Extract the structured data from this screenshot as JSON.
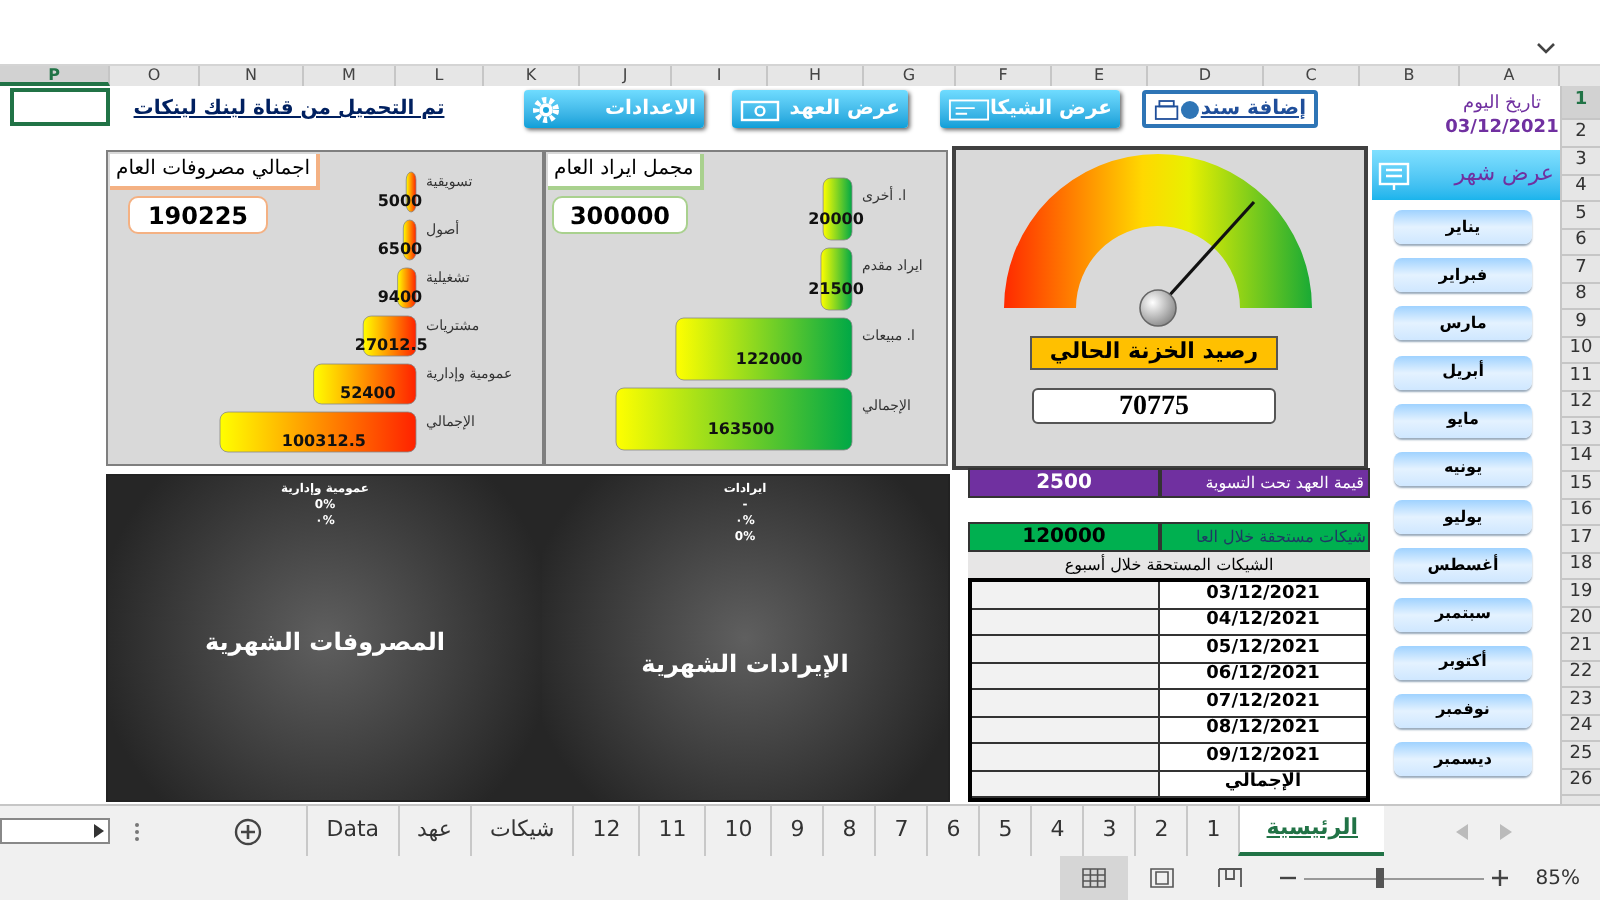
{
  "columns": [
    {
      "label": "A",
      "selected": false
    },
    {
      "label": "B",
      "selected": false
    },
    {
      "label": "C",
      "selected": false
    },
    {
      "label": "D",
      "selected": false
    },
    {
      "label": "E",
      "selected": false
    },
    {
      "label": "F",
      "selected": false
    },
    {
      "label": "G",
      "selected": false
    },
    {
      "label": "H",
      "selected": false
    },
    {
      "label": "I",
      "selected": false
    },
    {
      "label": "J",
      "selected": false
    },
    {
      "label": "K",
      "selected": false
    },
    {
      "label": "L",
      "selected": false
    },
    {
      "label": "M",
      "selected": false
    },
    {
      "label": "N",
      "selected": false
    },
    {
      "label": "O",
      "selected": false
    },
    {
      "label": "P",
      "selected": true
    }
  ],
  "rows": [
    {
      "label": "1",
      "selected": true
    },
    {
      "label": "2",
      "selected": false
    },
    {
      "label": "3",
      "selected": false
    },
    {
      "label": "4",
      "selected": false
    },
    {
      "label": "5",
      "selected": false
    },
    {
      "label": "6",
      "selected": false
    },
    {
      "label": "7",
      "selected": false
    },
    {
      "label": "8",
      "selected": false
    },
    {
      "label": "9",
      "selected": false
    },
    {
      "label": "10",
      "selected": false
    },
    {
      "label": "11",
      "selected": false
    },
    {
      "label": "12",
      "selected": false
    },
    {
      "label": "13",
      "selected": false
    },
    {
      "label": "14",
      "selected": false
    },
    {
      "label": "15",
      "selected": false
    },
    {
      "label": "16",
      "selected": false
    },
    {
      "label": "17",
      "selected": false
    },
    {
      "label": "18",
      "selected": false
    },
    {
      "label": "19",
      "selected": false
    },
    {
      "label": "20",
      "selected": false
    },
    {
      "label": "21",
      "selected": false
    },
    {
      "label": "22",
      "selected": false
    },
    {
      "label": "23",
      "selected": false
    },
    {
      "label": "24",
      "selected": false
    },
    {
      "label": "25",
      "selected": false
    },
    {
      "label": "26",
      "selected": false
    }
  ],
  "header": {
    "date_label": "تاريخ اليوم",
    "date": "03/12/2021",
    "link": "تم التحميل من قناة لينك لينكات",
    "buttons": [
      {
        "label": "إضافة سند",
        "kind": "voucher",
        "selected": true
      },
      {
        "label": "عرض الشيكا",
        "kind": "cheque",
        "selected": false
      },
      {
        "label": "عرض العهد",
        "kind": "cash",
        "selected": false
      },
      {
        "label": "الاعدادات",
        "kind": "settings",
        "selected": false
      }
    ]
  },
  "expenses": {
    "title": "اجمالي مصروفات العام",
    "total": "190225",
    "chart_data": {
      "type": "bar",
      "orientation": "horizontal",
      "data_labels": true,
      "categories": [
        "تسويقية",
        "أصول",
        "تشغيلية",
        "مشتريات",
        "عمومية وإدارية",
        "الإجمالي"
      ],
      "values": [
        5000,
        6500,
        9400,
        27012.5,
        52400,
        100312.5
      ]
    }
  },
  "revenue": {
    "title": "مجمل ايراد العام",
    "total": "300000",
    "chart_data": {
      "type": "bar",
      "orientation": "horizontal",
      "data_labels": true,
      "categories": [
        "ا. أخرى",
        "ايراد مقدم",
        "ا. مبيعات",
        "الإجمالي"
      ],
      "values": [
        20000,
        21500,
        122000,
        163500
      ]
    }
  },
  "treasury": {
    "title": "رصيد الخزنة الحالي",
    "value": "70775"
  },
  "month_view": {
    "button": "عرض شهر",
    "months": [
      "يناير",
      "فبراير",
      "مارس",
      "أبريل",
      "مايو",
      "يونيه",
      "يوليو",
      "أغسطس",
      "سبتمبر",
      "أكتوبر",
      "نوفمبر",
      "ديسمبر"
    ]
  },
  "monthly_charts": [
    {
      "title": "الإيرادات الشهرية",
      "labels": [
        "ايرادات",
        "-",
        "%٠",
        "0%"
      ]
    },
    {
      "title": "المصروفات الشهرية",
      "labels": [
        "عمومية وإدارية",
        "0%",
        "%٠"
      ]
    }
  ],
  "summary": {
    "custody": {
      "label": "قيمة العهد تحت التسوية",
      "value": "2500"
    },
    "cheques_year": {
      "label": "شيكات مستحقة خلال العا",
      "value": "120000"
    },
    "week_title": "الشيكات المستحقة خلال أسبوع",
    "week_rows": [
      "03/12/2021",
      "04/12/2021",
      "05/12/2021",
      "06/12/2021",
      "07/12/2021",
      "08/12/2021",
      "09/12/2021"
    ],
    "total_label": "الإجمالي"
  },
  "sheet_tabs": [
    {
      "label": "الرئيسية",
      "selected": true
    },
    {
      "label": "1",
      "selected": false
    },
    {
      "label": "2",
      "selected": false
    },
    {
      "label": "3",
      "selected": false
    },
    {
      "label": "4",
      "selected": false
    },
    {
      "label": "5",
      "selected": false
    },
    {
      "label": "6",
      "selected": false
    },
    {
      "label": "7",
      "selected": false
    },
    {
      "label": "8",
      "selected": false
    },
    {
      "label": "9",
      "selected": false
    },
    {
      "label": "10",
      "selected": false
    },
    {
      "label": "11",
      "selected": false
    },
    {
      "label": "12",
      "selected": false
    },
    {
      "label": "شيكات",
      "selected": false
    },
    {
      "label": "عهد",
      "selected": false
    },
    {
      "label": "Data",
      "selected": false
    }
  ],
  "status_bar": {
    "views": [
      {
        "kind": "normal",
        "selected": true
      },
      {
        "kind": "page_layout",
        "selected": false
      },
      {
        "kind": "page_break",
        "selected": false
      }
    ],
    "zoom": {
      "level": 0.42,
      "label": "85%"
    }
  }
}
